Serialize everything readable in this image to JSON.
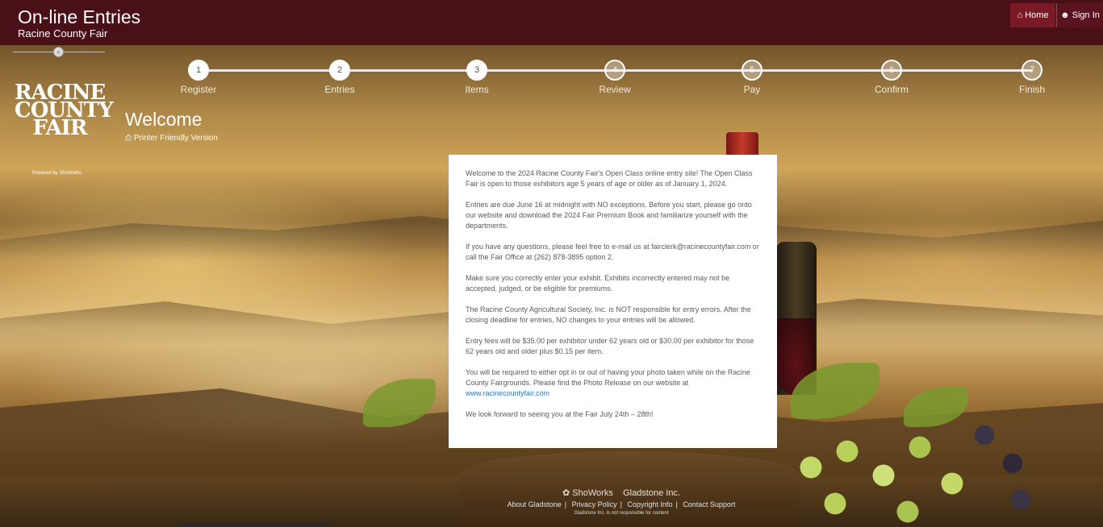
{
  "header": {
    "title": "On-line Entries",
    "subtitle": "Racine County Fair",
    "home_label": "Home",
    "signin_label": "Sign In"
  },
  "sidebar": {
    "logo_lines": [
      "RACINE",
      "COUNTY",
      "FAIR"
    ],
    "powered_by": "Powered by ShoWorks"
  },
  "steps": [
    {
      "number": "1",
      "label": "Register",
      "state": "done"
    },
    {
      "number": "2",
      "label": "Entries",
      "state": "done"
    },
    {
      "number": "3",
      "label": "Items",
      "state": "done"
    },
    {
      "number": "4",
      "label": "Review",
      "state": "todo"
    },
    {
      "number": "5",
      "label": "Pay",
      "state": "todo"
    },
    {
      "number": "6",
      "label": "Confirm",
      "state": "todo"
    },
    {
      "number": "7",
      "label": "Finish",
      "state": "todo"
    }
  ],
  "page": {
    "title": "Welcome",
    "printer_link": "Printer Friendly Version"
  },
  "content": {
    "p1": "Welcome to the 2024 Racine County Fair's Open Class online entry site!  The Open Class Fair is open to those exhibitors age 5 years of age or older as of January 1, 2024.",
    "p2": "Entries are due June 16 at midnight with NO exceptions.  Before you start, please go onto our website and download the 2024 Fair Premium Book and familiarize yourself with the departments.",
    "p3": "If you have any questions, please feel free to e-mail us at fairclerk@racinecountyfair.com or call the Fair Office at (262) 878-3895 option 2.",
    "p4": "Make sure you correctly enter your exhibit.  Exhibits incorrectly entered may not be accepted, judged, or be eligible for premiums.",
    "p5": "The Racine County Agricultural Society, Inc. is NOT responsible for entry errors.  After the closing deadline for entries, NO changes to your entries will be allowed.",
    "p6": "Entry fees will be $35.00 per exhibitor under 62 years old or $30.00 per exhibitor for those 62 years old and older plus $0.15 per item.",
    "p7": "You will be required to either opt in or out of having your photo taken while on the Racine County Fairgrounds. Please find the Photo Release on our website at",
    "p7_link": "www.racinecountyfair.com",
    "p8": "We look forward to seeing you at the Fair July 24th – 28th!"
  },
  "footer": {
    "brand": "ShoWorks",
    "company": "Gladstone Inc.",
    "links": [
      "About Gladstone",
      "Privacy Policy",
      "Copyright Info",
      "Contact Support"
    ],
    "disclaimer": "Gladstone Inc. is not responsible for content"
  },
  "colors": {
    "header_bg": "#4a1018",
    "home_bg": "#7a1a26",
    "link": "#2a7bbf"
  }
}
